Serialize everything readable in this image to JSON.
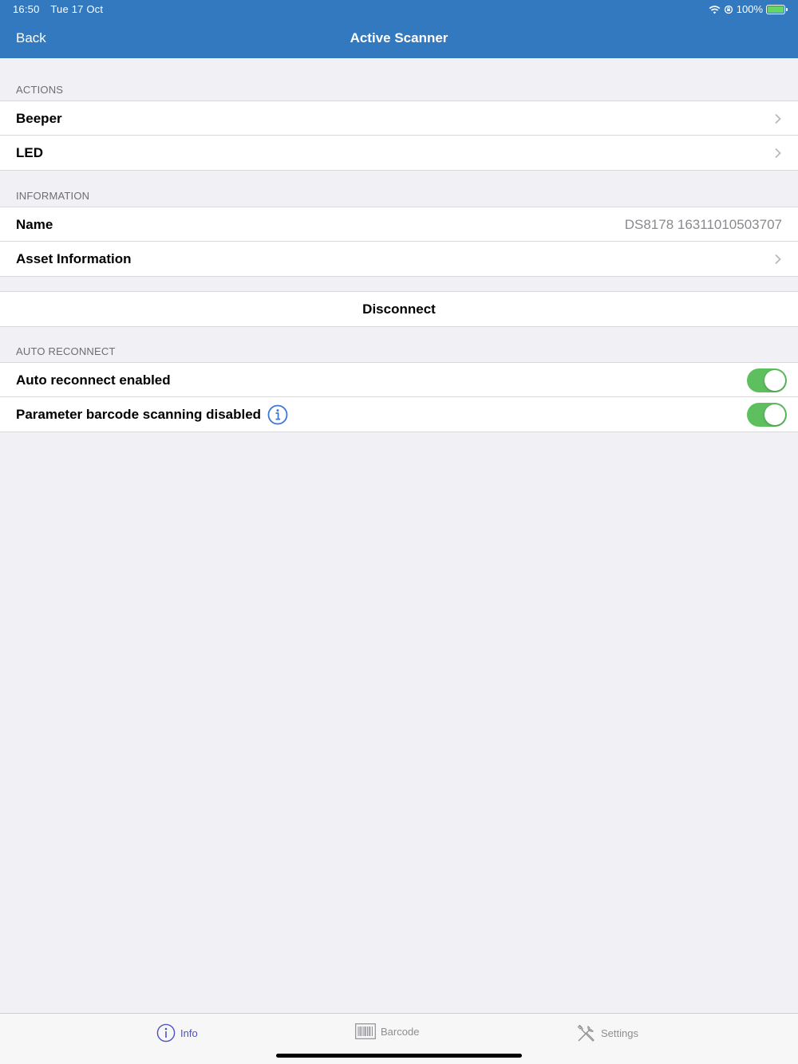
{
  "status_bar": {
    "time": "16:50",
    "date": "Tue 17 Oct",
    "battery": "100%",
    "battery_level": 1.0,
    "icons": [
      "wifi-icon",
      "rotation-lock-icon",
      "battery-charging-icon"
    ]
  },
  "nav": {
    "back_label": "Back",
    "title": "Active Scanner",
    "bar_color": "#3279c0"
  },
  "actions": {
    "header": "ACTIONS",
    "items": [
      {
        "label": "Beeper"
      },
      {
        "label": "LED"
      }
    ]
  },
  "information": {
    "header": "INFORMATION",
    "name_label": "Name",
    "name_value": "DS8178 16311010503707",
    "asset_label": "Asset Information"
  },
  "disconnect_label": "Disconnect",
  "auto_reconnect": {
    "header": "AUTO RECONNECT",
    "items": [
      {
        "label": "Auto reconnect enabled",
        "on": true
      },
      {
        "label": "Parameter barcode scanning disabled",
        "on": true
      }
    ],
    "toggle_color": "#5ebf5f"
  },
  "tabbar": {
    "tabs": [
      {
        "label": "Info",
        "icon": "info-icon",
        "active": true
      },
      {
        "label": "Barcode",
        "icon": "barcode-icon",
        "active": false
      },
      {
        "label": "Settings",
        "icon": "tools-icon",
        "active": false
      }
    ],
    "active_color": "#4a52c7"
  }
}
